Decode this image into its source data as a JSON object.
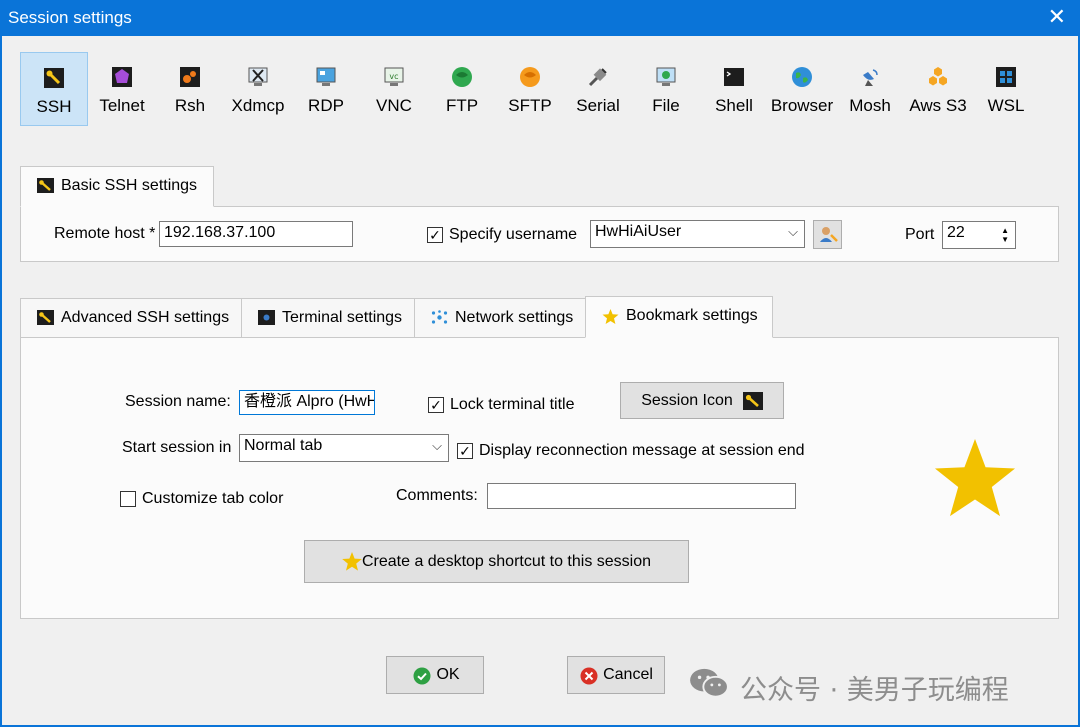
{
  "window": {
    "title": "Session settings"
  },
  "toolbar": [
    {
      "label": "SSH",
      "icon": "ssh-key-icon",
      "selected": true
    },
    {
      "label": "Telnet",
      "icon": "telnet-icon"
    },
    {
      "label": "Rsh",
      "icon": "rsh-icon"
    },
    {
      "label": "Xdmcp",
      "icon": "xdmcp-icon"
    },
    {
      "label": "RDP",
      "icon": "rdp-icon"
    },
    {
      "label": "VNC",
      "icon": "vnc-icon"
    },
    {
      "label": "FTP",
      "icon": "ftp-icon"
    },
    {
      "label": "SFTP",
      "icon": "sftp-icon"
    },
    {
      "label": "Serial",
      "icon": "serial-icon"
    },
    {
      "label": "File",
      "icon": "file-icon"
    },
    {
      "label": "Shell",
      "icon": "shell-icon"
    },
    {
      "label": "Browser",
      "icon": "browser-icon"
    },
    {
      "label": "Mosh",
      "icon": "mosh-icon"
    },
    {
      "label": "Aws S3",
      "icon": "aws-s3-icon"
    },
    {
      "label": "WSL",
      "icon": "wsl-icon"
    }
  ],
  "basic": {
    "tab_label": "Basic SSH settings",
    "remote_host_label": "Remote host *",
    "remote_host_value": "192.168.37.100",
    "specify_username_label": "Specify username",
    "specify_username_checked": true,
    "username_value": "HwHiAiUser",
    "port_label": "Port",
    "port_value": "22"
  },
  "tabs": [
    {
      "label": "Advanced SSH settings",
      "icon": "ssh-key-icon"
    },
    {
      "label": "Terminal settings",
      "icon": "terminal-icon"
    },
    {
      "label": "Network settings",
      "icon": "network-icon"
    },
    {
      "label": "Bookmark settings",
      "icon": "star-icon",
      "active": true
    }
  ],
  "bookmark": {
    "session_name_label": "Session name:",
    "session_name_value": "香橙派 Alpro (HwH",
    "lock_title_label": "Lock terminal title",
    "lock_title_checked": true,
    "session_icon_label": "Session Icon",
    "start_in_label": "Start session in",
    "start_in_value": "Normal tab",
    "reconnect_label": "Display reconnection message at session end",
    "reconnect_checked": true,
    "custom_color_label": "Customize tab color",
    "custom_color_checked": false,
    "comments_label": "Comments:",
    "comments_value": "",
    "shortcut_label": "Create a desktop shortcut to this session"
  },
  "footer": {
    "ok_label": "OK",
    "cancel_label": "Cancel"
  },
  "watermark": {
    "text": "公众号 · 美男子玩编程"
  },
  "colors": {
    "titlebar": "#0a74d8",
    "selected_tool": "#cce4f7",
    "star": "#f2c100",
    "ok_green": "#2ea043",
    "cancel_red": "#d93025"
  }
}
